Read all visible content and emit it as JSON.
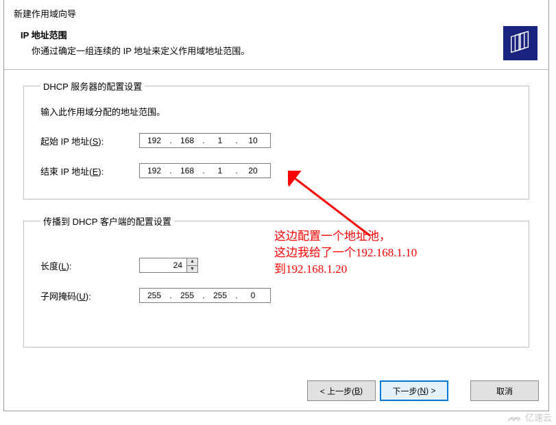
{
  "header": {
    "window_title": "新建作用域向导",
    "heading": "IP 地址范围",
    "description": "你通过确定一组连续的 IP 地址来定义作用域地址范围。",
    "wizard_icon": "scope-wizard-icon"
  },
  "server_config": {
    "legend": "DHCP 服务器的配置设置",
    "hint": "输入此作用域分配的地址范围。",
    "start_label_prefix": "起始 IP 地址(",
    "start_label_accel": "S",
    "start_label_suffix": "):",
    "start_ip": {
      "o1": "192",
      "o2": "168",
      "o3": "1",
      "o4": "10"
    },
    "end_label_prefix": "结束 IP 地址(",
    "end_label_accel": "E",
    "end_label_suffix": "):",
    "end_ip": {
      "o1": "192",
      "o2": "168",
      "o3": "1",
      "o4": "20"
    }
  },
  "client_config": {
    "legend": "传播到 DHCP 客户端的配置设置",
    "length_label_prefix": "长度(",
    "length_label_accel": "L",
    "length_label_suffix": "):",
    "length_value": "24",
    "mask_label_prefix": "子网掩码(",
    "mask_label_accel": "U",
    "mask_label_suffix": "):",
    "mask": {
      "o1": "255",
      "o2": "255",
      "o3": "255",
      "o4": "0"
    }
  },
  "annotation": {
    "line1": "这边配置一个地址池，",
    "line2": "这边我给了一个192.168.1.10",
    "line3": "到192.168.1.20"
  },
  "buttons": {
    "back_prefix": "< 上一步(",
    "back_accel": "B",
    "back_suffix": ")",
    "next_prefix": "下一步(",
    "next_accel": "N",
    "next_suffix": ") >",
    "cancel": "取消"
  },
  "watermark": "亿速云"
}
